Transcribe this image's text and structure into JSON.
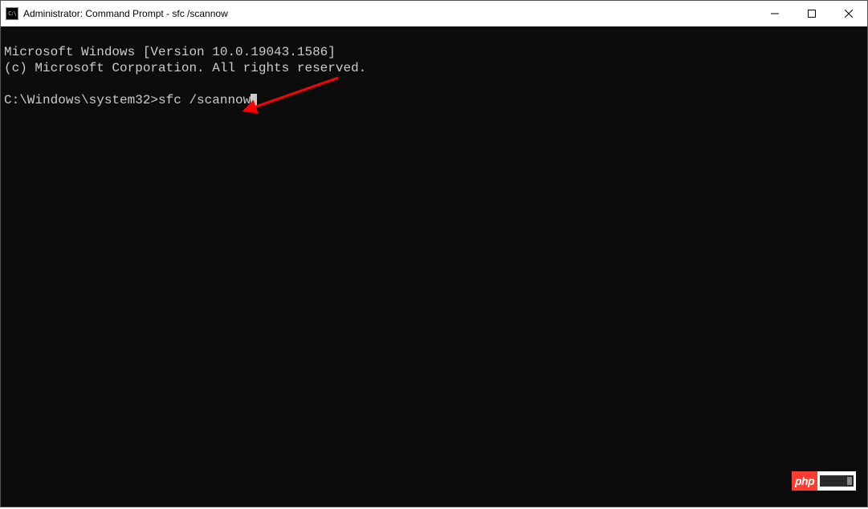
{
  "titlebar": {
    "title": "Administrator: Command Prompt - sfc  /scannow"
  },
  "terminal": {
    "line1": "Microsoft Windows [Version 10.0.19043.1586]",
    "line2": "(c) Microsoft Corporation. All rights reserved.",
    "blank": "",
    "prompt": "C:\\Windows\\system32>",
    "command": "sfc /scannow"
  },
  "watermark": {
    "text": "php"
  }
}
